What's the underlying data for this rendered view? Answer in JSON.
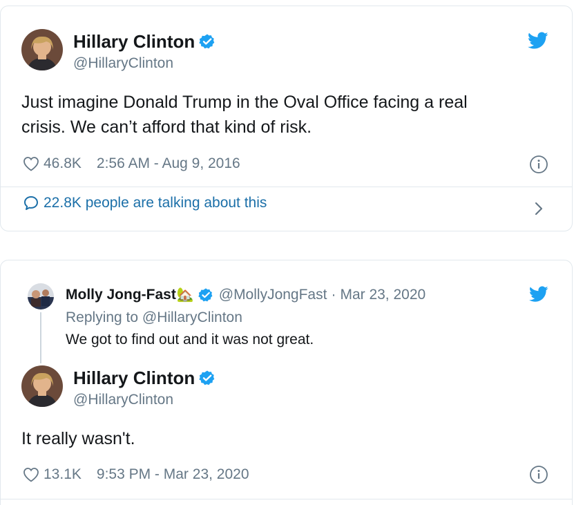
{
  "colors": {
    "brand_blue": "#1da1f2",
    "link_blue": "#1b6fa8",
    "secondary_text": "#657786",
    "border": "#e1e8ed"
  },
  "tweet1": {
    "author_name": "Hillary Clinton",
    "author_handle": "@HillaryClinton",
    "verified_icon": "verified-badge-icon",
    "brand_icon": "twitter-bird-icon",
    "text_line1": "Just imagine Donald Trump in the Oval Office facing a real",
    "text_line2": "crisis. We can’t afford that kind of risk.",
    "likes": "46.8K",
    "timestamp": "2:56 AM - Aug 9, 2016",
    "talking": "22.8K people are talking about this"
  },
  "tweet2": {
    "reply_author_name": "Molly Jong-Fast",
    "reply_author_emoji": "🏡",
    "reply_author_handle": "@MollyJongFast",
    "reply_separator": "·",
    "reply_date": "Mar 23, 2020",
    "replying_to": "Replying to @HillaryClinton",
    "reply_text": "We got to find out and it was not great.",
    "author_name": "Hillary Clinton",
    "author_handle": "@HillaryClinton",
    "text": "It really wasn't.",
    "likes": "13.1K",
    "timestamp": "9:53 PM - Mar 23, 2020"
  }
}
